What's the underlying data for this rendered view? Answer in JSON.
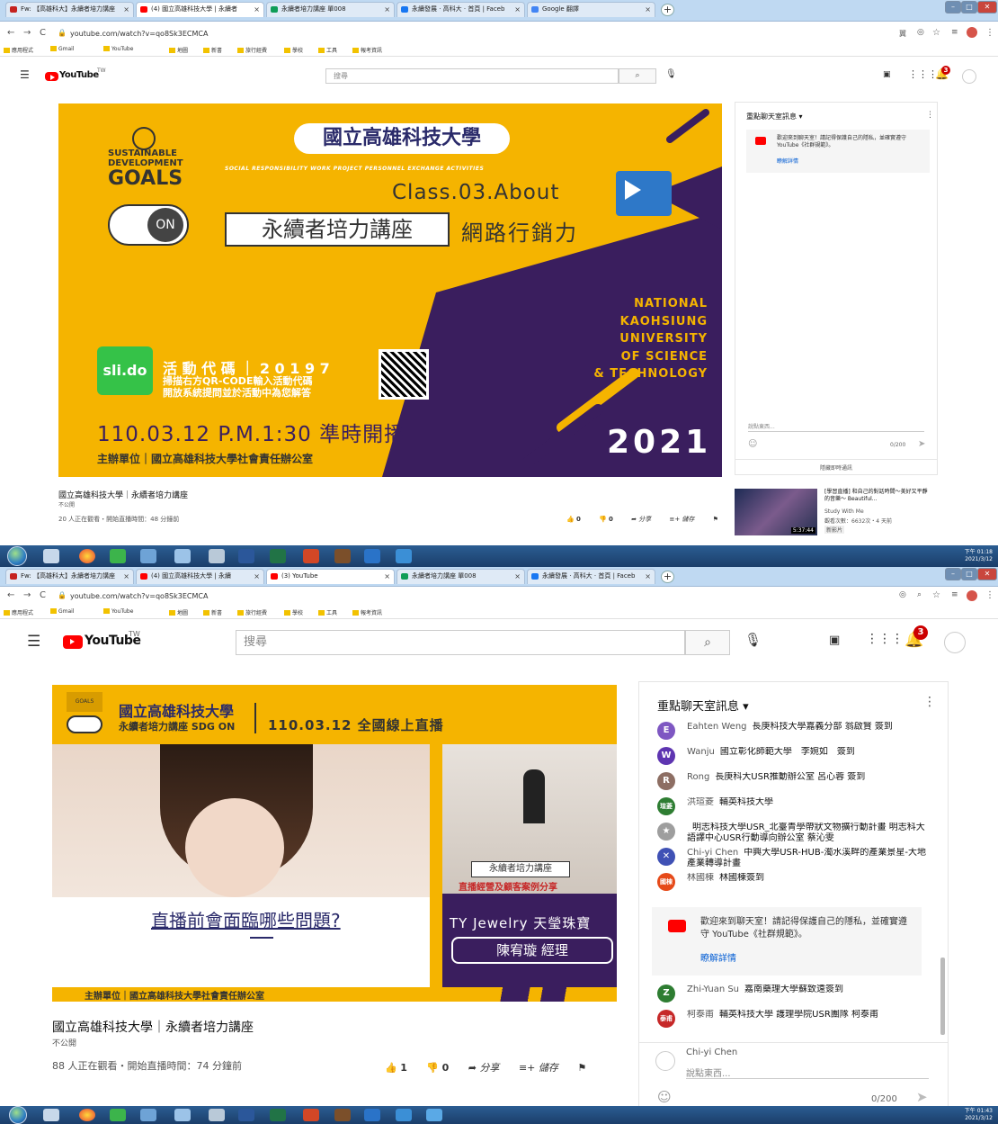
{
  "top": {
    "tabs": [
      {
        "label": "Fw: 【高雄科大】永續者培力講座",
        "color": "#c5221f"
      },
      {
        "label": "(4) 國立高雄科技大學 | 永續者",
        "color": "#ff0000"
      },
      {
        "label": "永續者培力講座 單008",
        "color": "#0f9d58"
      },
      {
        "label": "永續發展 · 高科大 · 首頁 | Faceb",
        "color": "#1877f2"
      },
      {
        "label": "Google 翻譯",
        "color": "#4285f4"
      }
    ],
    "url": "youtube.com/watch?v=qo8Sk3ECMCA",
    "bookmarks": [
      "應用程式",
      "Gmail",
      "YouTube",
      "地圖",
      "新書",
      "旅行經費",
      "學校",
      "工具",
      "報考資訊"
    ],
    "search_placeholder": "搜尋",
    "notification_count": "3",
    "video": {
      "sdg_line1": "SUSTAINABLE",
      "sdg_line2": "DEVELOPMENT",
      "sdg_goals": "GOALS",
      "toggle": "ON",
      "university": "國立高雄科技大學",
      "tagline": "SOCIAL RESPONSIBILITY WORK   PROJECT PERSONNEL EXCHANGE ACTIVITIES",
      "class_title": "Class.03.About",
      "series_name": "永續者培力講座",
      "topic": "網路行銷力",
      "slido": "sli.do",
      "event_code": "活 動 代 碼 ｜ 2 0 1 9 7",
      "scan_line1": "掃描右方QR-CODE輸入活動代碼",
      "scan_line2": "開放系統提問並於活動中為您解答",
      "datetime": "110.03.12 P.M.1:30 準時開播",
      "organizer": "主辦單位｜國立高雄科技大學社會責任辦公室",
      "national": [
        "NATIONAL",
        "KAOHSIUNG",
        "UNIVERSITY",
        "OF SCIENCE",
        "& TECHNOLOGY"
      ],
      "year": "2021"
    },
    "chat": {
      "title": "重點聊天室訊息 ▾",
      "welcome": "歡迎來到聊天室！請記得保護自己的隱私，並確實遵守 YouTube《社群規範》。",
      "learn_more": "瞭解詳情",
      "input_placeholder": "說點東西...",
      "char_count": "0/200",
      "hide_chat": "隱藏即時通訊"
    },
    "video_title": "國立高雄科技大學｜永續者培力講座",
    "visibility": "不公開",
    "viewers": "20 人正在觀看・開始直播時間：48 分鐘前",
    "likes": "0",
    "dislikes": "0",
    "share": "分享",
    "save": "儲存",
    "related": {
      "title": "[學習直播] 和自己的對話時間～美好又平靜的音樂～ Beautiful...",
      "channel": "Study With Me",
      "views": "觀看次數：6632次・4 天前",
      "badge": "新影片",
      "duration": "5:37:44"
    },
    "clock": {
      "time": "下午 01:18",
      "date": "2021/3/12"
    }
  },
  "bottom": {
    "tabs": [
      {
        "label": "Fw: 【高雄科大】永續者培力講座",
        "color": "#c5221f"
      },
      {
        "label": "(4) 國立高雄科技大學 | 永續",
        "color": "#ff0000"
      },
      {
        "label": "(3) YouTube",
        "color": "#ff0000"
      },
      {
        "label": "永續者培力講座 單008",
        "color": "#0f9d58"
      },
      {
        "label": "永續發展 · 高科大 · 首頁 | Faceb",
        "color": "#1877f2"
      }
    ],
    "url": "youtube.com/watch?v=qo8Sk3ECMCA",
    "search_placeholder": "搜尋",
    "notification_count": "3",
    "video": {
      "university": "國立高雄科技大學",
      "series": "永續者培力講座 SDG ON",
      "live": "110.03.12 全國線上直播",
      "question": "直播前會面臨哪些問題?",
      "screen_label": "直播經營及顧客案例分享",
      "jewelry": "TY Jewelry 天瑩珠寶",
      "speaker": "陳宥璇 經理",
      "organizer": "主辦單位｜國立高雄科技大學社會責任辦公室"
    },
    "chat": {
      "title": "重點聊天室訊息",
      "messages": [
        {
          "av": "E",
          "color": "#7e57c2",
          "who": "Eahten Weng",
          "text": "長庚科技大學嘉義分部 翁啟賢 簽到"
        },
        {
          "av": "W",
          "color": "#5e35b1",
          "who": "Wanju",
          "text": "國立彰化師範大學　李婉如　簽到"
        },
        {
          "av": "R",
          "color": "#8d6e63",
          "who": "Rong",
          "text": "長庚科大USR推動辦公室 呂心蓉 簽到"
        },
        {
          "av": "瑄菱",
          "color": "#2e7d32",
          "who": "洪瑄菱",
          "text": "輔英科技大學"
        },
        {
          "av": "★",
          "color": "#9e9e9e",
          "who": "",
          "text": "明志科技大學USR_北臺青學帶狀文物擴行動計畫 明志科大語譯中心USR行動導向辦公室 蔡沁雯"
        },
        {
          "av": "✕",
          "color": "#3f51b5",
          "who": "Chi-yi Chen",
          "text": "中興大學USR-HUB-濁水溪畔的產業景星-大地產業轉導計畫"
        },
        {
          "av": "國棟",
          "color": "#e64a19",
          "who": "林國棟",
          "text": "林國棟簽到"
        }
      ],
      "welcome": "歡迎來到聊天室！請記得保護自己的隱私，並確實遵守 YouTube《社群規範》。",
      "learn_more": "瞭解詳情",
      "messages2": [
        {
          "av": "Z",
          "color": "#2e7d32",
          "who": "Zhi-Yuan Su",
          "text": "嘉南藥理大學蘇致遠簽到"
        },
        {
          "av": "泰甫",
          "color": "#c62828",
          "who": "柯泰甫",
          "text": "輔英科技大學 護理學院USR團隊 柯泰甫"
        }
      ],
      "me": "Chi-yi Chen",
      "input_placeholder": "說點東西...",
      "char_count": "0/200"
    },
    "video_title": "國立高雄科技大學｜永續者培力講座",
    "visibility": "不公開",
    "viewers": "88 人正在觀看・開始直播時間：74 分鐘前",
    "likes": "1",
    "dislikes": "0",
    "share": "分享",
    "save": "儲存",
    "clock": {
      "time": "下午 01:43",
      "date": "2021/3/12"
    }
  }
}
